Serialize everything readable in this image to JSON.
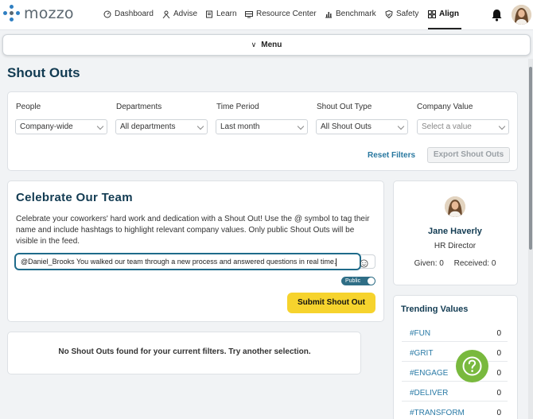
{
  "brand": {
    "logo_text": "mozzo"
  },
  "nav": {
    "items": [
      {
        "label": "Dashboard",
        "icon": "gauge-icon"
      },
      {
        "label": "Advise",
        "icon": "person-icon"
      },
      {
        "label": "Learn",
        "icon": "book-icon"
      },
      {
        "label": "Resource Center",
        "icon": "monitor-icon"
      },
      {
        "label": "Benchmark",
        "icon": "bar-chart-icon"
      },
      {
        "label": "Safety",
        "icon": "shield-icon"
      },
      {
        "label": "Align",
        "icon": "grid-icon",
        "active": true
      }
    ]
  },
  "menu": {
    "label": "Menu"
  },
  "page": {
    "title": "Shout Outs"
  },
  "filters": {
    "people": {
      "label": "People",
      "value": "Company-wide"
    },
    "departments": {
      "label": "Departments",
      "value": "All departments"
    },
    "time_period": {
      "label": "Time Period",
      "value": "Last month"
    },
    "type": {
      "label": "Shout Out Type",
      "value": "All Shout Outs"
    },
    "company_value": {
      "label": "Company Value",
      "placeholder": "Select a value"
    },
    "reset_label": "Reset Filters",
    "export_label": "Export Shout Outs"
  },
  "celebrate": {
    "title": "Celebrate Our Team",
    "description": "Celebrate your coworkers' hard work and dedication with a Shout Out! Use the @ symbol to tag their name and include hashtags to highlight relevant company values. Only public Shout Outs will be visible in the feed.",
    "input_value": "@Daniel_Brooks You walked our team through a new process and answered questions in real time.",
    "toggle_label": "Public",
    "submit_label": "Submit Shout Out"
  },
  "feed": {
    "empty_message": "No Shout Outs found for your current filters. Try another selection."
  },
  "profile": {
    "name": "Jane Haverly",
    "role": "HR Director",
    "given": "Given: 0",
    "received": "Received: 0"
  },
  "trending": {
    "title": "Trending Values",
    "items": [
      {
        "tag": "#FUN",
        "count": "0"
      },
      {
        "tag": "#GRIT",
        "count": "0"
      },
      {
        "tag": "#ENGAGE",
        "count": "0"
      },
      {
        "tag": "#DELIVER",
        "count": "0"
      },
      {
        "tag": "#TRANSFORM",
        "count": "0"
      }
    ]
  },
  "colors": {
    "accent": "#123b52",
    "link": "#27779f",
    "submit": "#f6d32d",
    "help": "#79b93e"
  }
}
